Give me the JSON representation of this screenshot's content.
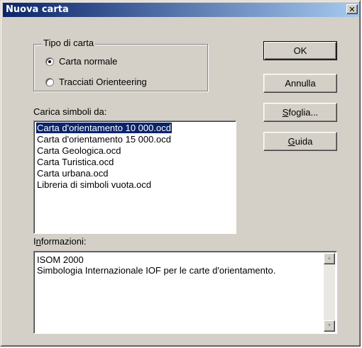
{
  "window": {
    "title": "Nuova carta",
    "close_glyph": "✕"
  },
  "map_type": {
    "group_label": "Tipo di carta",
    "options": [
      {
        "label": "Carta normale",
        "selected": true
      },
      {
        "label": "Tracciati Orienteering",
        "selected": false
      }
    ]
  },
  "symbols": {
    "label": "Carica simboli da:",
    "items": [
      "Carta d'orientamento 10 000.ocd",
      "Carta d'orientamento 15 000.ocd",
      "Carta Geologica.ocd",
      "Carta Turistica.ocd",
      "Carta urbana.ocd",
      "Libreria di simboli vuota.ocd"
    ],
    "selected_index": 0
  },
  "buttons": {
    "ok": "OK",
    "cancel": "Annulla",
    "browse_pre": "",
    "browse_key": "S",
    "browse_post": "foglia...",
    "help_pre": "",
    "help_key": "G",
    "help_post": "uida"
  },
  "info": {
    "label_pre": "I",
    "label_key": "n",
    "label_post": "formazioni:",
    "lines": [
      "ISOM 2000",
      "Simbologia Internazionale IOF per le carte d'orientamento."
    ]
  },
  "icons": {
    "close": "close-icon",
    "scroll_up": "scroll-up-arrow-icon",
    "scroll_down": "scroll-down-arrow-icon"
  },
  "colors": {
    "titlebar_start": "#0a246a",
    "titlebar_end": "#a6caf0",
    "face": "#d4d0c8",
    "selection": "#0a246a"
  }
}
